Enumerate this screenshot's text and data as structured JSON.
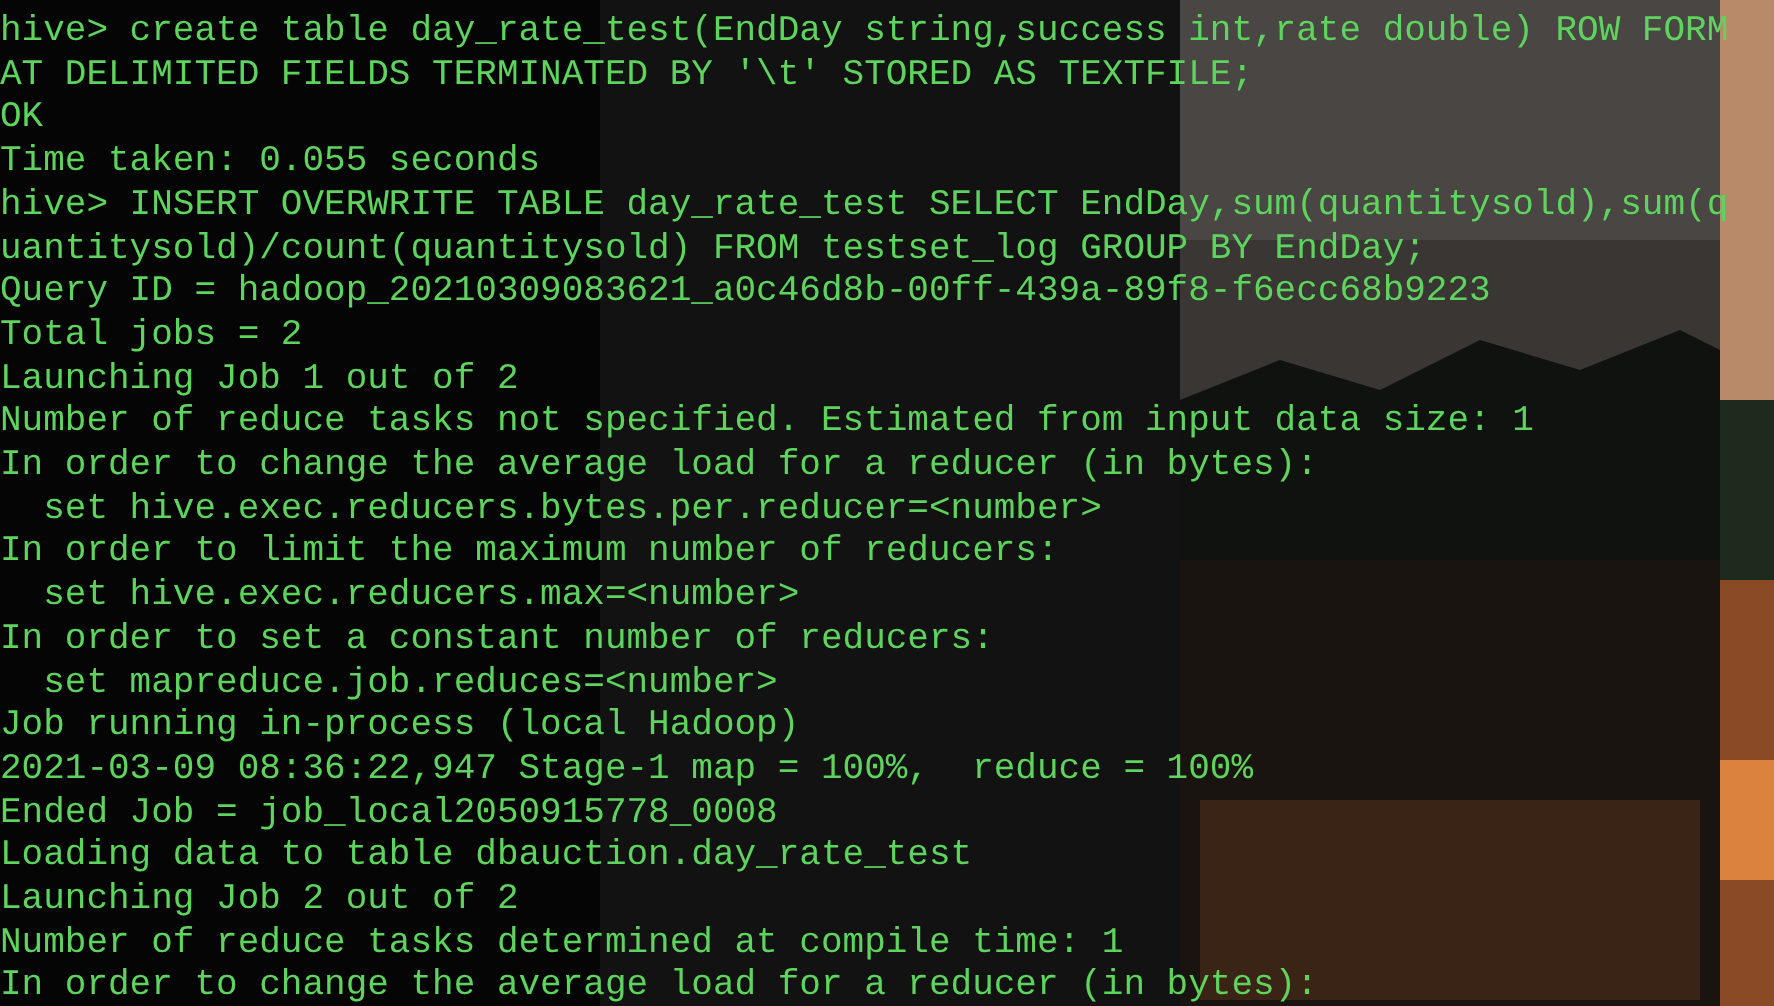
{
  "terminal": {
    "lines": [
      "hive> create table day_rate_test(EndDay string,success int,rate double) ROW FORM",
      "AT DELIMITED FIELDS TERMINATED BY '\\t' STORED AS TEXTFILE;",
      "OK",
      "Time taken: 0.055 seconds",
      "hive> INSERT OVERWRITE TABLE day_rate_test SELECT EndDay,sum(quantitysold),sum(q",
      "uantitysold)/count(quantitysold) FROM testset_log GROUP BY EndDay;",
      "Query ID = hadoop_20210309083621_a0c46d8b-00ff-439a-89f8-f6ecc68b9223",
      "Total jobs = 2",
      "Launching Job 1 out of 2",
      "Number of reduce tasks not specified. Estimated from input data size: 1",
      "In order to change the average load for a reducer (in bytes):",
      "  set hive.exec.reducers.bytes.per.reducer=<number>",
      "In order to limit the maximum number of reducers:",
      "  set hive.exec.reducers.max=<number>",
      "In order to set a constant number of reducers:",
      "  set mapreduce.job.reduces=<number>",
      "Job running in-process (local Hadoop)",
      "2021-03-09 08:36:22,947 Stage-1 map = 100%,  reduce = 100%",
      "Ended Job = job_local2050915778_0008",
      "Loading data to table dbauction.day_rate_test",
      "Launching Job 2 out of 2",
      "Number of reduce tasks determined at compile time: 1",
      "In order to change the average load for a reducer (in bytes):"
    ]
  }
}
